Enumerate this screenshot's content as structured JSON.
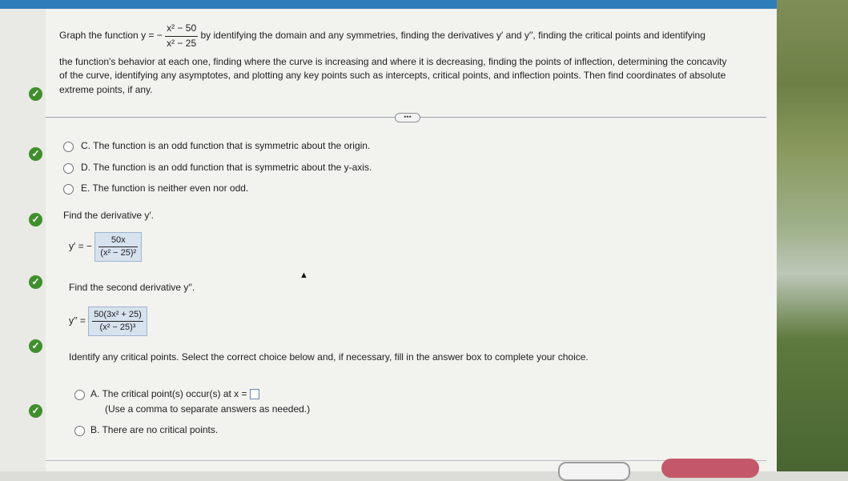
{
  "question": {
    "lead": "Graph the function y = −",
    "numerator": "x² − 50",
    "denominator": "x² − 25",
    "line1_rest": "by identifying the domain and any symmetries, finding the derivatives y′ and y′′, finding the critical points and identifying",
    "line2": "the function's behavior at each one, finding where the curve is increasing and where it is decreasing, finding the points of inflection, determining the concavity",
    "line3": "of the curve, identifying any asymptotes, and plotting any key points such as intercepts, critical points, and inflection points. Then find coordinates of absolute",
    "line4": "extreme points, if any."
  },
  "more_label": "•••",
  "symmetry_options": [
    {
      "letter": "C.",
      "text": "The function is an odd function that is symmetric about the origin."
    },
    {
      "letter": "D.",
      "text": "The function is an odd function that is symmetric about the y-axis."
    },
    {
      "letter": "E.",
      "text": "The function is neither even nor odd."
    }
  ],
  "derivative": {
    "prompt": "Find the derivative y′.",
    "lhs": "y′ = −",
    "numerator": "50x",
    "denominator": "(x² − 25)²"
  },
  "second_derivative": {
    "prompt": "Find the second derivative y′′.",
    "lhs": "y′′ =",
    "numerator": "50(3x² + 25)",
    "denominator": "(x² − 25)³"
  },
  "critical": {
    "prompt": "Identify any critical points. Select the correct choice below and, if necessary, fill in the answer box to complete your choice.",
    "option_a_letter": "A.",
    "option_a_text": "The critical point(s) occur(s) at x =",
    "option_a_note": "(Use a comma to separate answers as needed.)",
    "option_b_letter": "B.",
    "option_b_text": "There are no critical points."
  },
  "colors": {
    "accent_blue": "#2f7db8",
    "check_green": "#3f8f2c",
    "answer_box": "#d7e2ef",
    "bottom_button": "#c4586a"
  },
  "icons": [
    "checkmark-icon",
    "cursor-icon"
  ]
}
